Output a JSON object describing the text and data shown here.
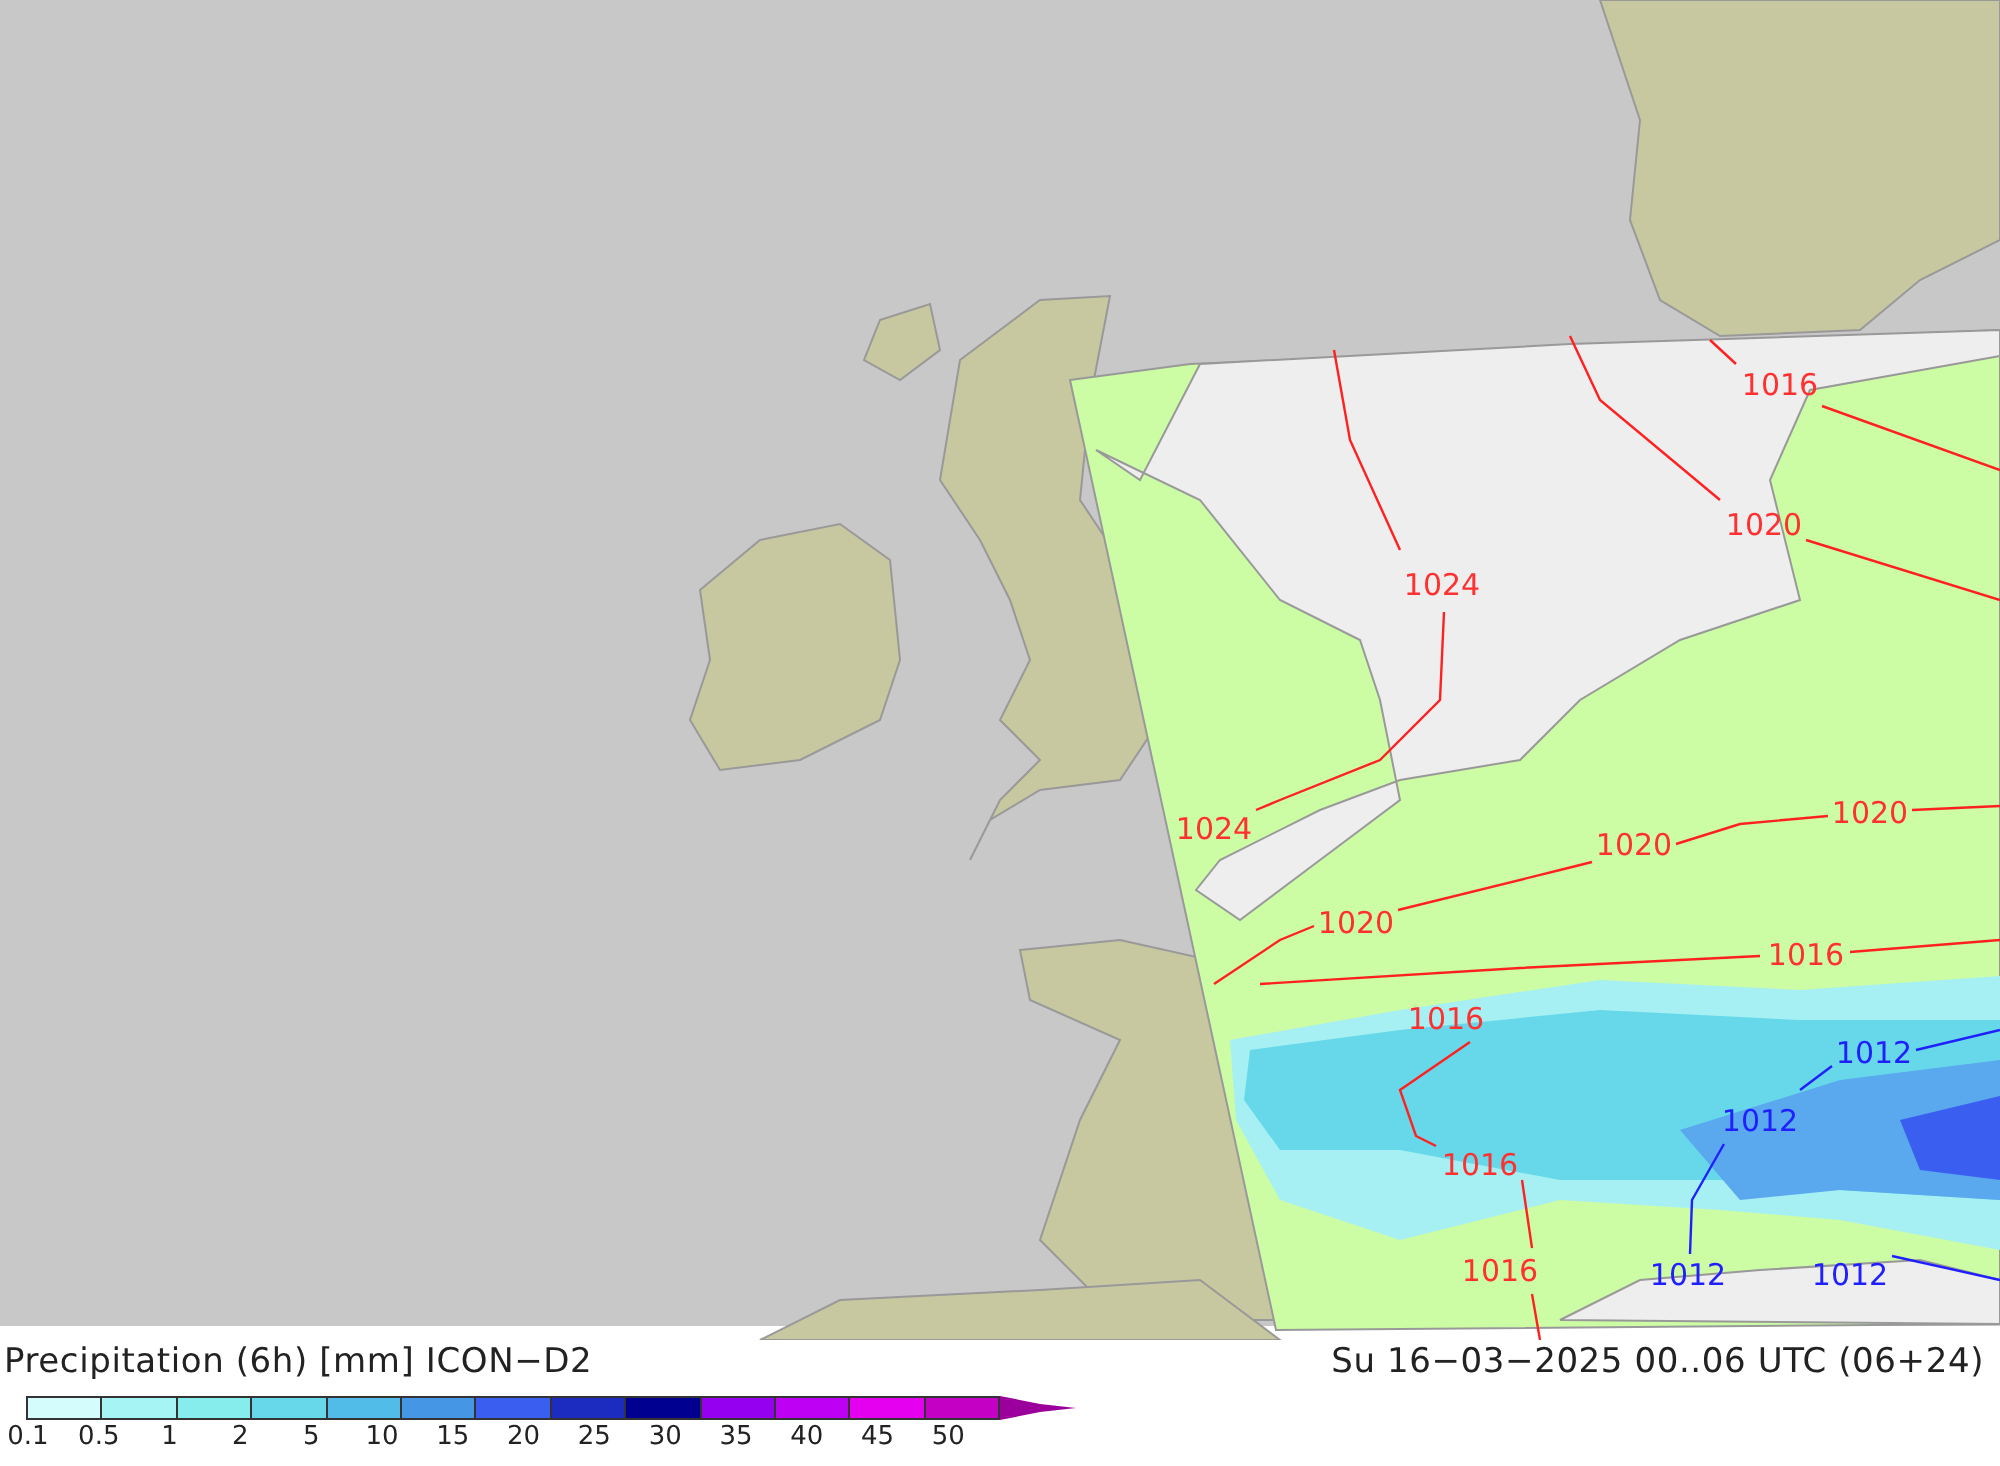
{
  "map": {
    "isobar_labels": [
      {
        "text": "1016",
        "color": "#ff3030"
      },
      {
        "text": "1020",
        "color": "#ff3030"
      },
      {
        "text": "1024",
        "color": "#ff3030"
      },
      {
        "text": "1024",
        "color": "#ff3030"
      },
      {
        "text": "1020",
        "color": "#ff3030"
      },
      {
        "text": "1020",
        "color": "#ff3030"
      },
      {
        "text": "1020",
        "color": "#ff3030"
      },
      {
        "text": "1016",
        "color": "#ff3030"
      },
      {
        "text": "1016",
        "color": "#ff3030"
      },
      {
        "text": "1012",
        "color": "#2020ff"
      },
      {
        "text": "1012",
        "color": "#2020ff"
      },
      {
        "text": "1016",
        "color": "#ff3030"
      },
      {
        "text": "1016",
        "color": "#ff3030"
      },
      {
        "text": "1012",
        "color": "#2020ff"
      },
      {
        "text": "1012",
        "color": "#2020ff"
      }
    ]
  },
  "footer": {
    "title": "Precipitation (6h) [mm] ICON−D2",
    "datetime": "Su 16−03−2025 00..06 UTC (06+24)"
  },
  "legend": {
    "bins": [
      {
        "color": "#d4fcfc"
      },
      {
        "color": "#a6f4f4"
      },
      {
        "color": "#86ecec"
      },
      {
        "color": "#66d8ea"
      },
      {
        "color": "#52bce8"
      },
      {
        "color": "#4696e6"
      },
      {
        "color": "#3a5ef0"
      },
      {
        "color": "#1c2cc0"
      },
      {
        "color": "#000090"
      },
      {
        "color": "#9600f0"
      },
      {
        "color": "#be00f5"
      },
      {
        "color": "#e600f0"
      },
      {
        "color": "#c300c3"
      }
    ],
    "overflow": {
      "color": "#9c009c"
    },
    "ticks": [
      "0.1",
      "0.5",
      "1",
      "2",
      "5",
      "10",
      "15",
      "20",
      "25",
      "30",
      "35",
      "40",
      "45",
      "50"
    ]
  }
}
